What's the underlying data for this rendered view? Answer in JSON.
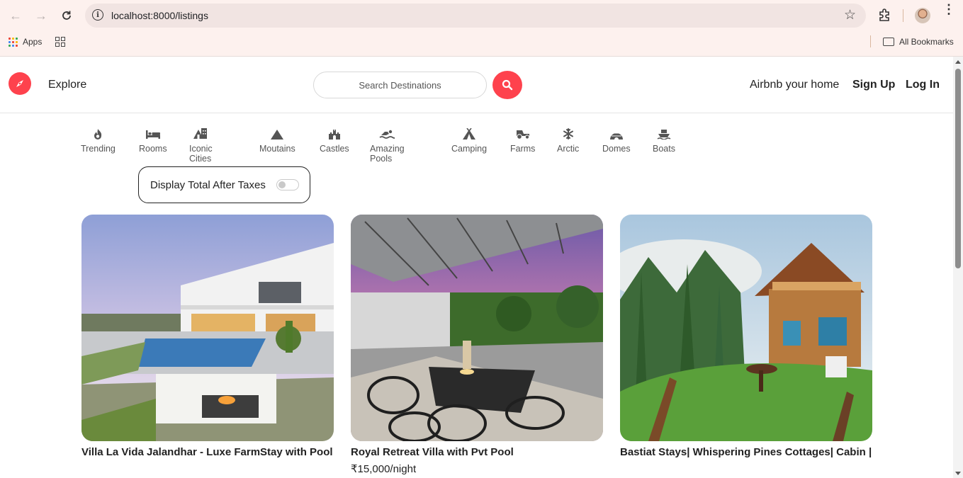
{
  "browser": {
    "url": "localhost:8000/listings",
    "bookmarks": {
      "apps_label": "Apps",
      "all_bookmarks_label": "All Bookmarks"
    }
  },
  "navbar": {
    "explore_label": "Explore",
    "search_placeholder": "Search Destinations",
    "host_label": "Airbnb your home",
    "signup_label": "Sign Up",
    "login_label": "Log In",
    "brand_color": "#fe424d"
  },
  "filters": [
    {
      "label": "Trending",
      "icon": "fire-icon"
    },
    {
      "label": "Rooms",
      "icon": "bed-icon"
    },
    {
      "label": "Iconic Cities",
      "icon": "city-icon"
    },
    {
      "label": "Moutains",
      "icon": "mountain-icon"
    },
    {
      "label": "Castles",
      "icon": "castle-icon"
    },
    {
      "label": "Amazing Pools",
      "icon": "swimmer-icon"
    },
    {
      "label": "Camping",
      "icon": "tent-icon"
    },
    {
      "label": "Farms",
      "icon": "tractor-icon"
    },
    {
      "label": "Arctic",
      "icon": "snowflake-icon"
    },
    {
      "label": "Domes",
      "icon": "igloo-icon"
    },
    {
      "label": "Boats",
      "icon": "ship-icon"
    }
  ],
  "tax_toggle": {
    "label": "Display Total After Taxes",
    "on": false
  },
  "listings": [
    {
      "title": "Villa La Vida Jalandhar - Luxe FarmStay with Pool",
      "price": ""
    },
    {
      "title": "Royal Retreat Villa with Pvt Pool",
      "price": "₹15,000/night"
    },
    {
      "title": "Bastiat Stays| Whispering Pines Cottages| Cabin |",
      "price": ""
    }
  ]
}
